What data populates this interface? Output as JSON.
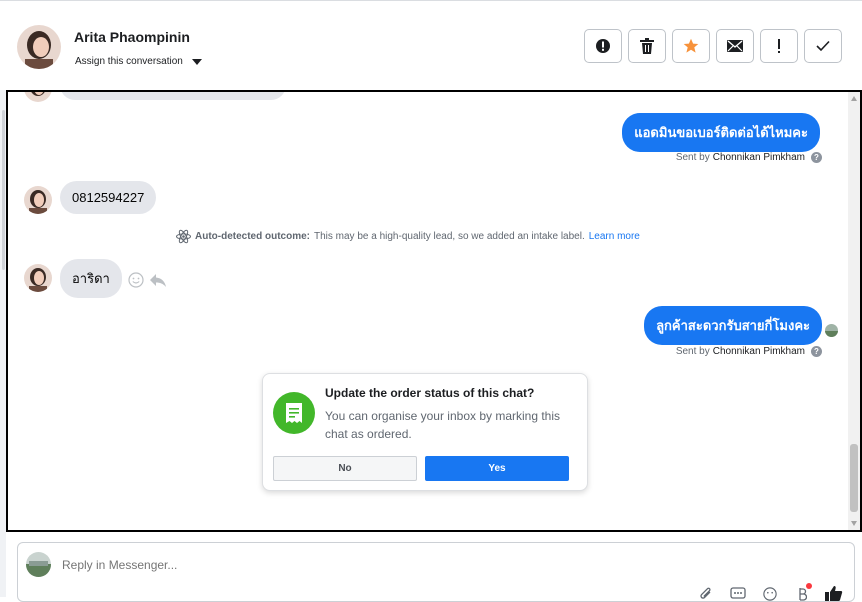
{
  "header": {
    "contact_name": "Arita Phaompinin",
    "assign_label": "Assign this conversation",
    "toolbar": [
      {
        "name": "spam",
        "icon": "alert-circle-icon"
      },
      {
        "name": "delete",
        "icon": "trash-icon"
      },
      {
        "name": "star",
        "icon": "star-icon"
      },
      {
        "name": "mark-unread",
        "icon": "envelope-icon"
      },
      {
        "name": "follow-up",
        "icon": "exclamation-icon"
      },
      {
        "name": "done",
        "icon": "check-icon"
      }
    ],
    "star_color": "#f7923b"
  },
  "messages": {
    "m1": {
      "direction": "outgoing",
      "text": "แอดมินขอเบอร์ติดต่อได้ไหมคะ"
    },
    "m1_sent_prefix": "Sent by",
    "m1_sender": "Chonnikan Pimkham",
    "m2": {
      "direction": "incoming",
      "text": "0812594227"
    },
    "outcome": {
      "label": "Auto-detected outcome:",
      "text": "This may be a high-quality lead, so we added an intake label.",
      "link": "Learn more"
    },
    "m3": {
      "direction": "incoming",
      "text": "อาริดา"
    },
    "m4": {
      "direction": "outgoing",
      "text": "ลูกค้าสะดวกรับสายกี่โมงคะ"
    },
    "m4_sent_prefix": "Sent by",
    "m4_sender": "Chonnikan Pimkham"
  },
  "order_prompt": {
    "title": "Update the order status of this chat?",
    "body": "You can organise your inbox by marking this chat as ordered.",
    "no_label": "No",
    "yes_label": "Yes"
  },
  "composer": {
    "placeholder": "Reply in Messenger...",
    "tools": [
      "paperclip-icon",
      "chat-template-icon",
      "emoji-icon",
      "currency-icon",
      "thumbs-up-icon"
    ]
  },
  "colors": {
    "accent": "#1877f2",
    "incoming_bubble": "#e4e6eb",
    "success": "#42b72a"
  }
}
